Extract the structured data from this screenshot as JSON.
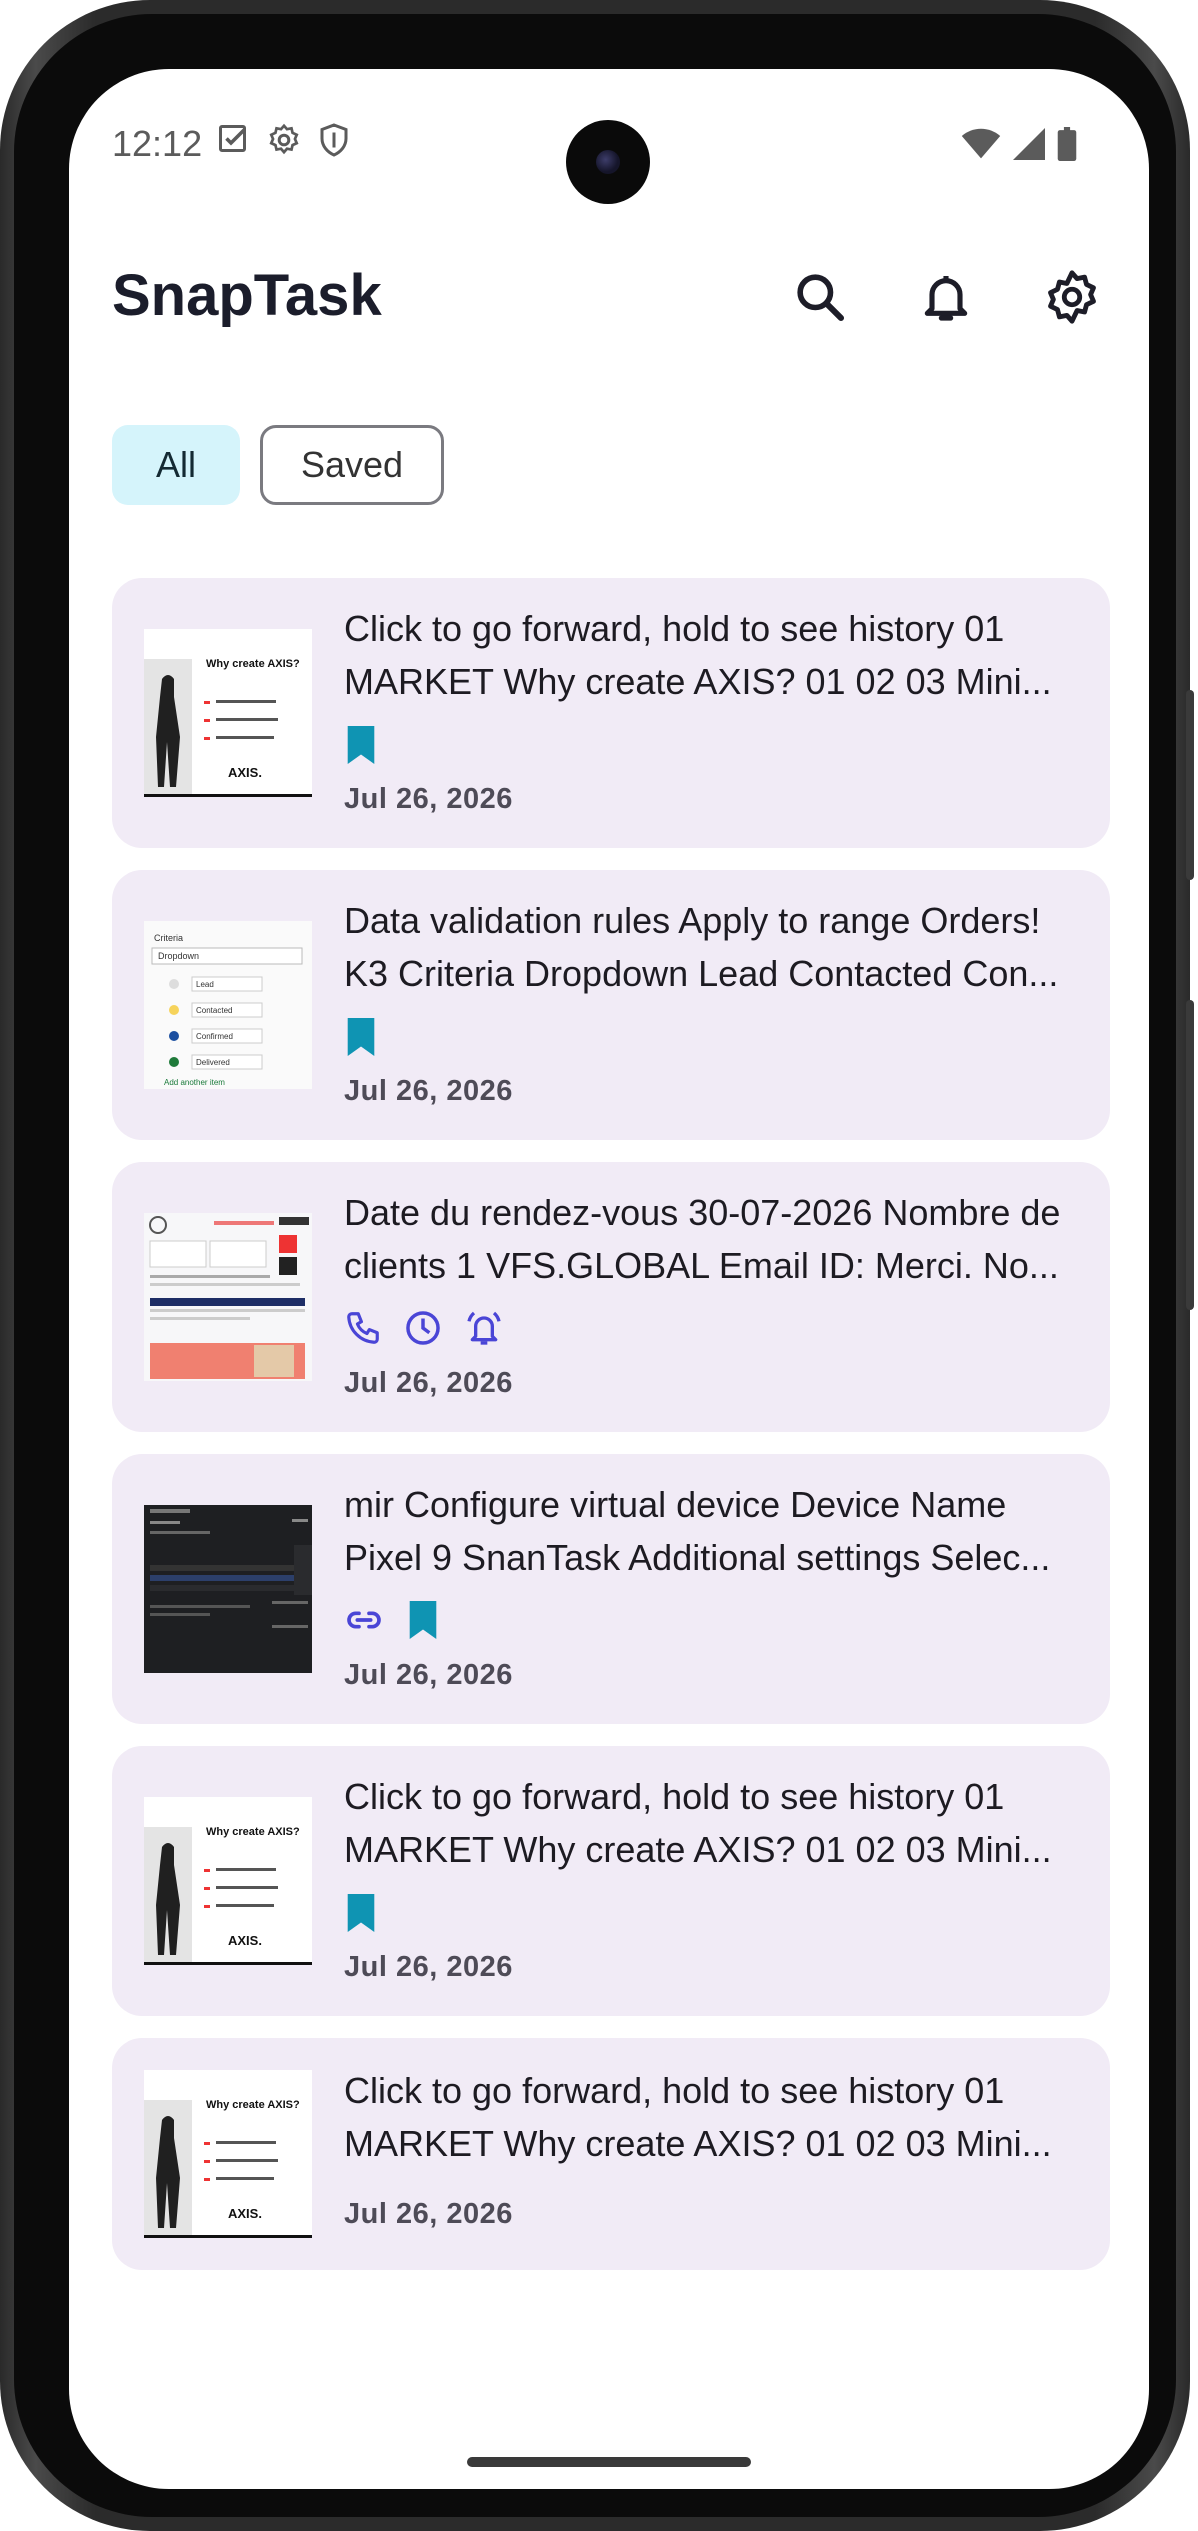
{
  "status": {
    "time": "12:12"
  },
  "app": {
    "title": "SnapTask"
  },
  "filters": {
    "all": "All",
    "saved": "Saved"
  },
  "colors": {
    "accent": "#0f94b3",
    "chip_selected": "#d5f4fb",
    "card_bg": "#f1ebf6",
    "meta_icon_blue": "#4a45d6"
  },
  "cards": [
    {
      "line1": "Click to go forward, hold to see history 01",
      "line2": "MARKET Why create AXIS? 01 02 03 Mini...",
      "icons": [
        "bookmark-icon"
      ],
      "date": "Jul 26, 2026",
      "thumb_title": "Why create AXIS?",
      "thumb_brand": "AXIS."
    },
    {
      "line1": "Data validation rules Apply to range Orders!",
      "line2": "K3 Criteria Dropdown Lead Contacted Con...",
      "icons": [
        "bookmark-icon"
      ],
      "date": "Jul 26, 2026",
      "thumb_title": "Criteria",
      "thumb_dropdown": "Dropdown",
      "thumb_items": [
        "Lead",
        "Contacted",
        "Confirmed",
        "Delivered"
      ],
      "thumb_add": "Add another item"
    },
    {
      "line1": "Date du rendez-vous 30-07-2026 Nombre de",
      "line2": "clients 1 VFS.GLOBAL Email ID: Merci. No...",
      "icons": [
        "phone-icon",
        "clock-icon",
        "alarm-icon"
      ],
      "date": "Jul 26, 2026"
    },
    {
      "line1": "mir Configure virtual device Device Name",
      "line2": "Pixel 9 SnanTask Additional settings Selec...",
      "icons": [
        "link-icon",
        "bookmark-icon"
      ],
      "date": "Jul 26, 2026"
    },
    {
      "line1": "Click to go forward, hold to see history 01",
      "line2": "MARKET Why create AXIS? 01 02 03 Mini...",
      "icons": [
        "bookmark-icon"
      ],
      "date": "Jul 26, 2026",
      "thumb_title": "Why create AXIS?",
      "thumb_brand": "AXIS."
    },
    {
      "line1": "Click to go forward, hold to see history 01",
      "line2": "MARKET Why create AXIS? 01 02 03 Mini...",
      "icons": [],
      "date": "Jul 26, 2026",
      "thumb_title": "Why create AXIS?",
      "thumb_brand": "AXIS."
    }
  ]
}
